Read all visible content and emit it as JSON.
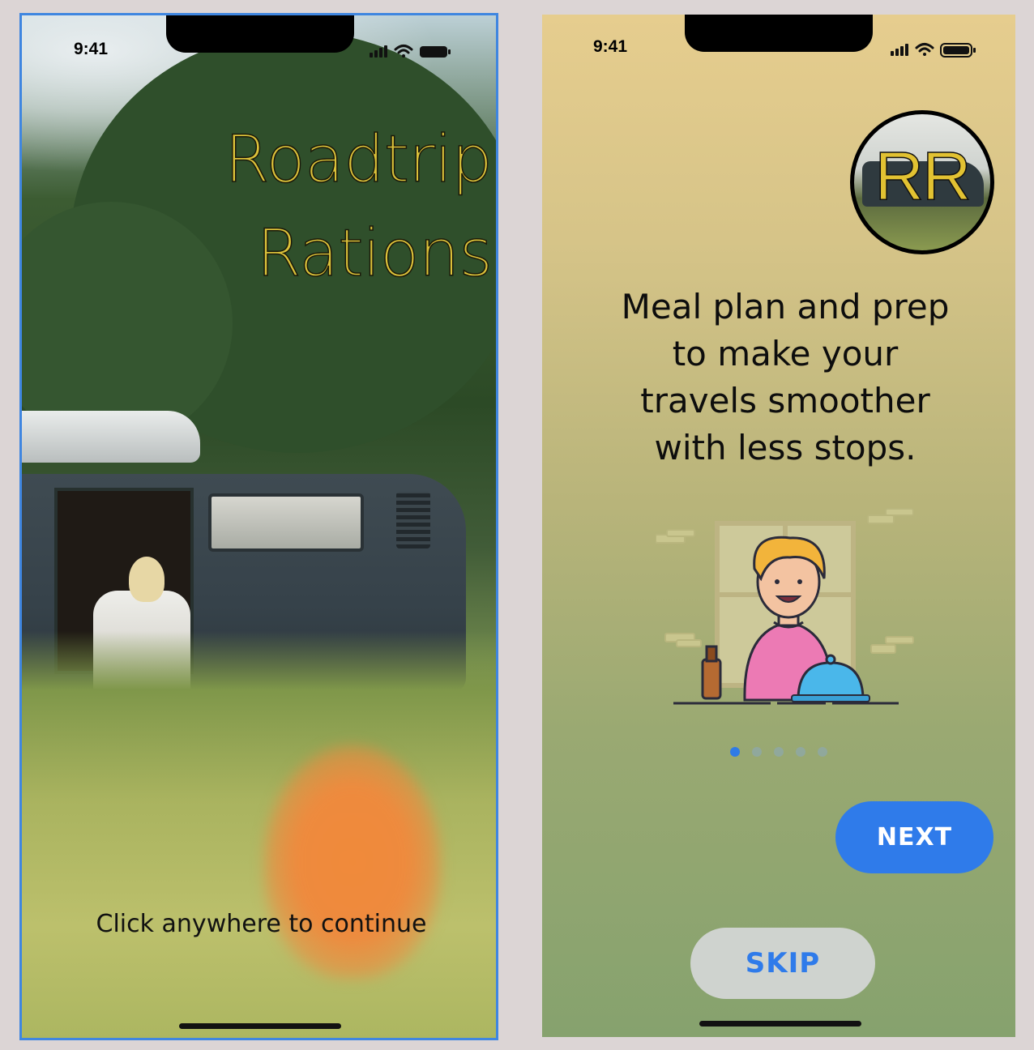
{
  "status_bar": {
    "time": "9:41",
    "icons": [
      "signal-icon",
      "wifi-icon",
      "battery-icon"
    ]
  },
  "splash": {
    "title_line1": "Roadtrip",
    "title_line2": "Rations",
    "cta": "Click anywhere to continue",
    "title_color": "#dcc23a",
    "frame_border_color": "#3f86e0"
  },
  "onboarding": {
    "avatar_initials": "RR",
    "tagline_lines": [
      "Meal plan and prep",
      "to make your",
      "travels smoother",
      "with less stops."
    ],
    "pagination": {
      "total": 5,
      "active": 1
    },
    "next_label": "NEXT",
    "skip_label": "SKIP",
    "accent_color": "#2f7bea"
  }
}
